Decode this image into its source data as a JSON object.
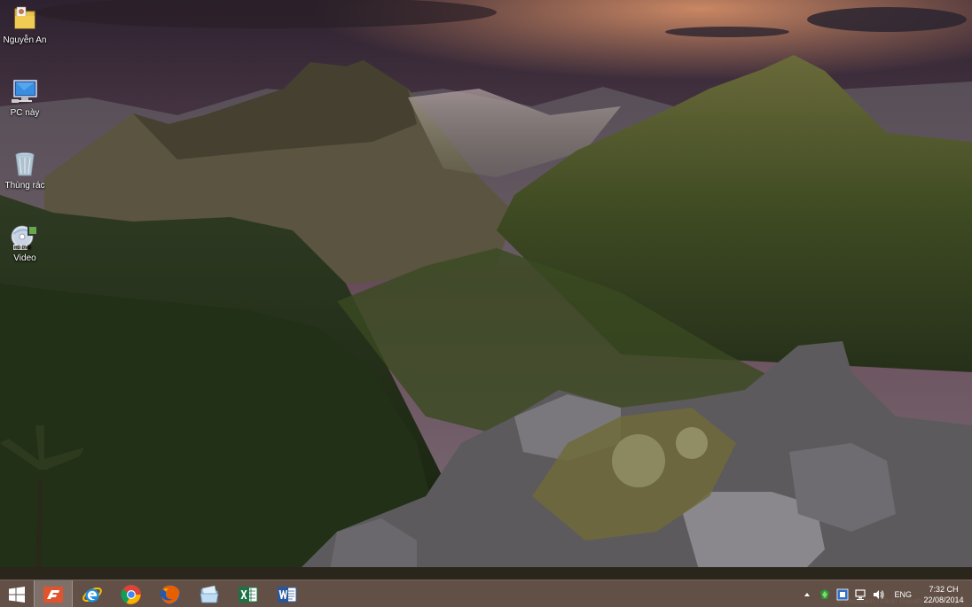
{
  "desktop": {
    "icons": [
      {
        "label": "Nguyễn An",
        "icon": "user-folder-icon"
      },
      {
        "label": "PC này",
        "icon": "computer-icon"
      },
      {
        "label": "Thùng rác",
        "icon": "recycle-bin-icon"
      },
      {
        "label": "Video",
        "icon": "dvd-video-icon"
      }
    ]
  },
  "taskbar": {
    "apps": [
      {
        "name": "start-button",
        "icon": "windows-logo-icon"
      },
      {
        "name": "foxit-reader",
        "icon": "foxit-icon",
        "active": true
      },
      {
        "name": "internet-explorer",
        "icon": "ie-icon"
      },
      {
        "name": "google-chrome",
        "icon": "chrome-icon"
      },
      {
        "name": "firefox",
        "icon": "firefox-icon"
      },
      {
        "name": "file-explorer",
        "icon": "folder-icon"
      },
      {
        "name": "microsoft-excel",
        "icon": "excel-icon"
      },
      {
        "name": "microsoft-word",
        "icon": "word-icon"
      }
    ],
    "tray": {
      "language": "ENG",
      "time": "7:32 CH",
      "date": "22/08/2014"
    }
  },
  "colors": {
    "taskbar": "#5c483a",
    "excel": "#1e7145",
    "word": "#2b579a",
    "foxit": "#e0532d"
  }
}
